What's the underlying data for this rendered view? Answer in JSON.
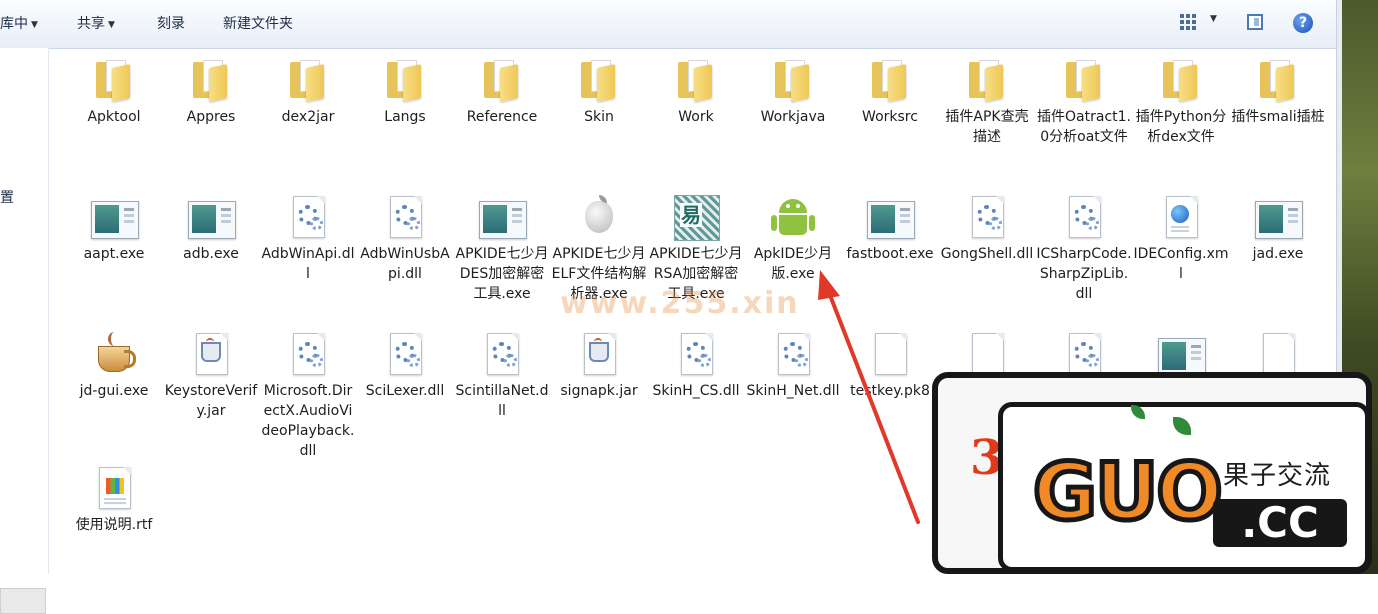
{
  "toolbar": {
    "library_label": "库中",
    "share_label": "共享",
    "burn_label": "刻录",
    "new_folder_label": "新建文件夹",
    "help_label": "?"
  },
  "nav": {
    "partial_label": "置"
  },
  "rows": [
    [
      {
        "label": "Apktool",
        "icon": "folder-icon"
      },
      {
        "label": "Appres",
        "icon": "folder-icon"
      },
      {
        "label": "dex2jar",
        "icon": "folder-icon"
      },
      {
        "label": "Langs",
        "icon": "folder-icon"
      },
      {
        "label": "Reference",
        "icon": "folder-icon"
      },
      {
        "label": "Skin",
        "icon": "folder-icon"
      },
      {
        "label": "Work",
        "icon": "folder-icon"
      },
      {
        "label": "Workjava",
        "icon": "folder-icon"
      },
      {
        "label": "Worksrc",
        "icon": "folder-icon"
      },
      {
        "label": "插件APK查壳描述",
        "icon": "folder-icon"
      },
      {
        "label": "插件Oatract1.0分析oat文件",
        "icon": "folder-icon"
      },
      {
        "label": "插件Python分析dex文件",
        "icon": "folder-icon"
      },
      {
        "label": "插件smali插桩",
        "icon": "folder-icon"
      }
    ],
    [
      {
        "label": "aapt.exe",
        "icon": "application-icon"
      },
      {
        "label": "adb.exe",
        "icon": "application-icon"
      },
      {
        "label": "AdbWinApi.dll",
        "icon": "dll-gear-icon"
      },
      {
        "label": "AdbWinUsbApi.dll",
        "icon": "dll-gear-icon"
      },
      {
        "label": "APKIDE七少月DES加密解密工具.exe",
        "icon": "application-icon"
      },
      {
        "label": "APKIDE七少月ELF文件结构解析器.exe",
        "icon": "apple-icon"
      },
      {
        "label": "APKIDE七少月RSA加密解密工具.exe",
        "icon": "rsa-tool-icon"
      },
      {
        "label": "ApkIDE少月版.exe",
        "icon": "android-icon"
      },
      {
        "label": "fastboot.exe",
        "icon": "application-icon"
      },
      {
        "label": "GongShell.dll",
        "icon": "dll-gear-icon"
      },
      {
        "label": "ICSharpCode.SharpZipLib.dll",
        "icon": "dll-gear-icon"
      },
      {
        "label": "IDEConfig.xml",
        "icon": "xml-globe-icon"
      },
      {
        "label": "jad.exe",
        "icon": "application-icon"
      }
    ],
    [
      {
        "label": "jd-gui.exe",
        "icon": "coffee-cup-icon"
      },
      {
        "label": "KeystoreVerify.jar",
        "icon": "java-jar-icon"
      },
      {
        "label": "Microsoft.DirectX.AudioVideoPlayback.dll",
        "icon": "dll-gear-icon"
      },
      {
        "label": "SciLexer.dll",
        "icon": "dll-gear-icon"
      },
      {
        "label": "ScintillaNet.dll",
        "icon": "dll-gear-icon"
      },
      {
        "label": "signapk.jar",
        "icon": "java-jar-icon"
      },
      {
        "label": "SkinH_CS.dll",
        "icon": "dll-gear-icon"
      },
      {
        "label": "SkinH_Net.dll",
        "icon": "dll-gear-icon"
      },
      {
        "label": "testkey.pk8",
        "icon": "blank-file-icon"
      }
    ],
    [
      {
        "label": "使用说明.rtf",
        "icon": "rtf-document-icon"
      }
    ]
  ],
  "watermark": {
    "text": "www.255.xin"
  },
  "logo": {
    "number": "3",
    "brand": "GUO",
    "cn": "果子交流",
    "tld": ".CC"
  },
  "colors": {
    "accent_red": "#e0392a",
    "folder_yellow": "#eec856",
    "logo_orange": "#f08a26"
  }
}
